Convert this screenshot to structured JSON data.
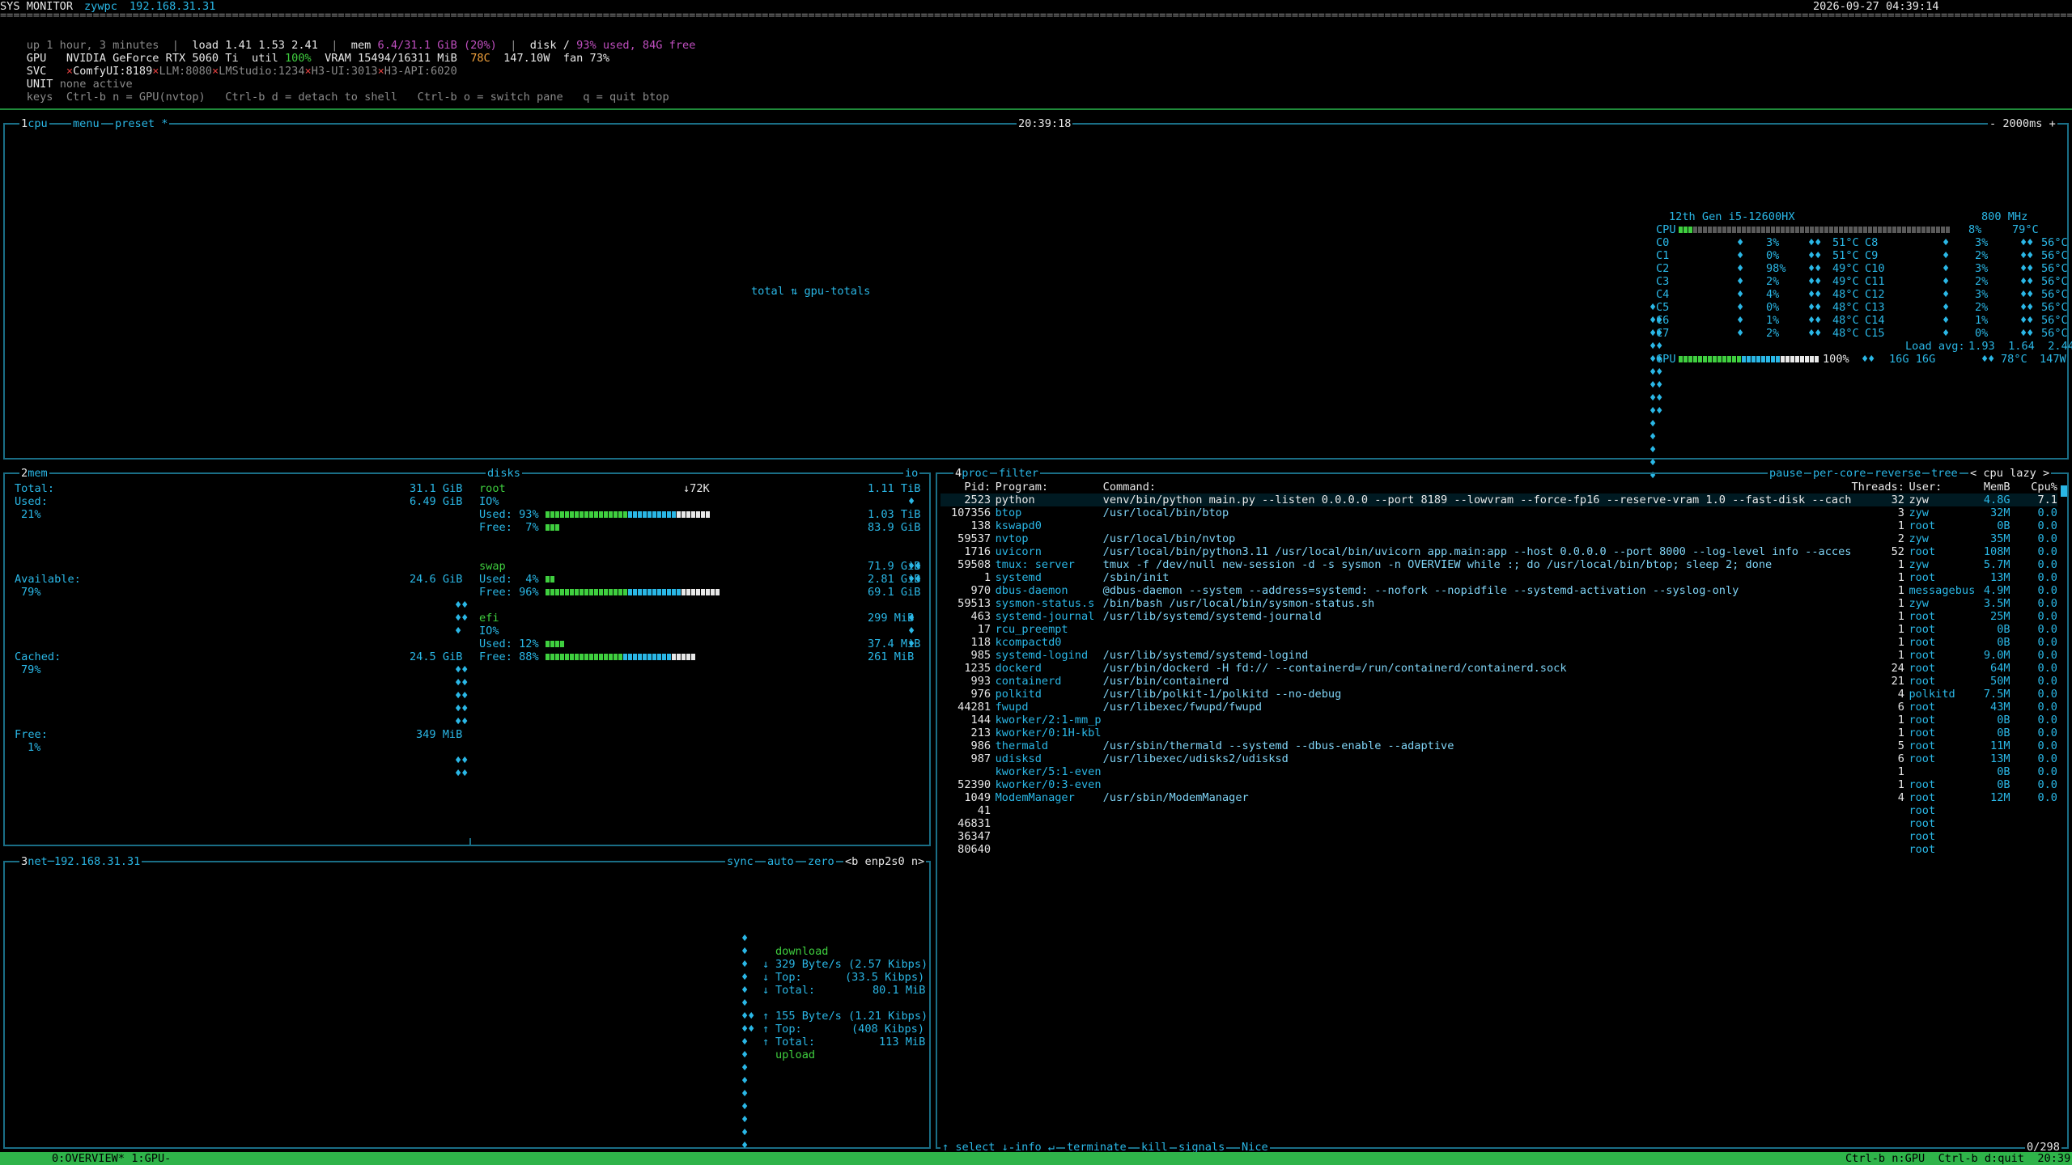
{
  "header": {
    "title": "SYS MONITOR",
    "user": "zywpc",
    "ip": "192.168.31.31",
    "datetime": "2026-09-27 04:39:14",
    "separator_line": "==========================================================================================================================================================================================================================================================================================================================================================",
    "uptime": "up 1 hour, 3 minutes",
    "load_label": "load",
    "load_values": "1.41 1.53 2.41",
    "mem_label": "mem",
    "mem_value": "6.4/31.1 GiB (20%)",
    "disk_label": "disk /",
    "disk_value": "93% used, 84G free",
    "gpu_line_label": "GPU",
    "gpu_name": "NVIDIA GeForce RTX 5060 Ti",
    "gpu_util_label": "util",
    "gpu_util": "100%",
    "gpu_vram_label": "VRAM",
    "gpu_vram": "15494/16311 MiB",
    "gpu_temp": "78C",
    "gpu_power": "147.10W",
    "gpu_fan_label": "fan",
    "gpu_fan": "73%",
    "svc_label": "SVC",
    "services": [
      {
        "mark": "×",
        "name": "ComfyUI:8189",
        "color": "#e8e8e8"
      },
      {
        "mark": "×",
        "name": "LLM:8080",
        "color": "#8a8a8a"
      },
      {
        "mark": "×",
        "name": "LMStudio:1234",
        "color": "#8a8a8a"
      },
      {
        "mark": "×",
        "name": "H3-UI:3013",
        "color": "#8a8a8a"
      },
      {
        "mark": "×",
        "name": "H3-API:6020",
        "color": "#8a8a8a"
      }
    ],
    "unit_label": "UNIT",
    "unit_value": "none active",
    "keys_label": "keys",
    "keys_value": "Ctrl-b n = GPU(nvtop)   Ctrl-b d = detach to shell   Ctrl-b o = switch pane   q = quit btop"
  },
  "cpu_box": {
    "tabs": [
      "cpu",
      "menu",
      "preset *"
    ],
    "tab_num": "1",
    "clock": "20:39:18",
    "interval": "- 2000ms +",
    "center_label": "total ⇅ gpu-totals",
    "cpu_model": "12th Gen i5-12600HX",
    "freq": "800 MHz",
    "cpu_total_label": "CPU",
    "cpu_total_pct": "8%",
    "cpu_total_temp": "79°C",
    "cores_left": [
      {
        "name": "C0",
        "pct": "3%",
        "temp": "51°C"
      },
      {
        "name": "C1",
        "pct": "0%",
        "temp": "51°C"
      },
      {
        "name": "C2",
        "pct": "98%",
        "temp": "49°C"
      },
      {
        "name": "C3",
        "pct": "2%",
        "temp": "49°C"
      },
      {
        "name": "C4",
        "pct": "4%",
        "temp": "48°C"
      },
      {
        "name": "C5",
        "pct": "0%",
        "temp": "48°C"
      },
      {
        "name": "C6",
        "pct": "1%",
        "temp": "48°C"
      },
      {
        "name": "C7",
        "pct": "2%",
        "temp": "48°C"
      }
    ],
    "cores_right": [
      {
        "name": "C8",
        "pct": "3%",
        "temp": "56°C"
      },
      {
        "name": "C9",
        "pct": "2%",
        "temp": "56°C"
      },
      {
        "name": "C10",
        "pct": "3%",
        "temp": "56°C"
      },
      {
        "name": "C11",
        "pct": "2%",
        "temp": "56°C"
      },
      {
        "name": "C12",
        "pct": "3%",
        "temp": "56°C"
      },
      {
        "name": "C13",
        "pct": "2%",
        "temp": "56°C"
      },
      {
        "name": "C14",
        "pct": "1%",
        "temp": "56°C"
      },
      {
        "name": "C15",
        "pct": "0%",
        "temp": "56°C"
      }
    ],
    "load_avg_label": "Load avg:",
    "load_avg": "1.93  1.64  2.44",
    "gpu_label": "GPU",
    "gpu_pct": "100%",
    "gpu_mem": "16G 16G",
    "gpu_temp": "78°C",
    "gpu_power": "147W"
  },
  "mem_box": {
    "tab_num": "2",
    "title": "mem",
    "total_label": "Total:",
    "total": "31.1 GiB",
    "used_label": "Used:",
    "used": "6.49 GiB",
    "used_pct": "21%",
    "available_label": "Available:",
    "available": "24.6 GiB",
    "available_pct": "79%",
    "cached_label": "Cached:",
    "cached": "24.5 GiB",
    "cached_pct": "79%",
    "free_label": "Free:",
    "free": "349 MiB",
    "free_pct": "1%"
  },
  "disks_box": {
    "title": "disks",
    "io_label": "io",
    "io_rate": "↓72K",
    "disks": [
      {
        "name": "root",
        "size": "1.11 TiB",
        "io": "IO%",
        "used_label": "Used:",
        "used_pct": "93%",
        "used": "1.03 TiB",
        "free_label": "Free:",
        "free_pct": "7%",
        "free": "83.9 GiB",
        "used_frac": 0.93,
        "free_frac": 0.07
      },
      {
        "name": "swap",
        "size": "71.9 GiB",
        "io": "",
        "used_label": "Used:",
        "used_pct": "4%",
        "used": "2.81 GiB",
        "free_label": "Free:",
        "free_pct": "96%",
        "free": "69.1 GiB",
        "used_frac": 0.04,
        "free_frac": 0.96
      },
      {
        "name": "efi",
        "size": "299 MiB",
        "io": "IO%",
        "used_label": "Used:",
        "used_pct": "12%",
        "used": "37.4 MiB",
        "free_label": "Free:",
        "free_pct": "88%",
        "free": "261 MiB",
        "used_frac": 0.12,
        "free_frac": 0.88
      }
    ]
  },
  "net_box": {
    "tab_num": "3",
    "title": "net",
    "ip": "192.168.31.31",
    "controls": [
      "sync",
      "auto",
      "zero",
      "<b enp2s0 n>"
    ],
    "download_label": "download",
    "down_rate": "329 Byte/s (2.57 Kibps)",
    "down_top_label": "Top:",
    "down_top": "(33.5 Kibps)",
    "down_total_label": "Total:",
    "down_total": "80.1 MiB",
    "up_rate": "155 Byte/s (1.21 Kibps)",
    "up_top_label": "Top:",
    "up_top": "(408 Kibps)",
    "up_total_label": "Total:",
    "up_total": "113 MiB",
    "upload_label": "upload"
  },
  "proc_box": {
    "tab_num": "4",
    "title": "proc",
    "filter_label": "filter",
    "controls": [
      "pause",
      "per-core",
      "reverse",
      "tree",
      "< cpu lazy >"
    ],
    "columns": {
      "pid": "Pid:",
      "program": "Program:",
      "command": "Command:",
      "threads": "Threads:",
      "user": "User:",
      "mem": "MemB",
      "cpu": "Cpu%"
    },
    "rows": [
      {
        "pid": "2523",
        "program": "python",
        "command": "venv/bin/python main.py --listen 0.0.0.0 --port 8189 --lowvram --force-fp16 --reserve-vram 1.0 --fast-disk --cach",
        "threads": "32",
        "user": "zyw",
        "mem": "4.8G",
        "cpu": "7.1"
      },
      {
        "pid": "107356",
        "program": "btop",
        "command": "/usr/local/bin/btop",
        "threads": "3",
        "user": "zyw",
        "mem": "32M",
        "cpu": "0.0"
      },
      {
        "pid": "138",
        "program": "kswapd0",
        "command": "",
        "threads": "1",
        "user": "root",
        "mem": "0B",
        "cpu": "0.0"
      },
      {
        "pid": "59537",
        "program": "nvtop",
        "command": "/usr/local/bin/nvtop",
        "threads": "2",
        "user": "zyw",
        "mem": "35M",
        "cpu": "0.0"
      },
      {
        "pid": "1716",
        "program": "uvicorn",
        "command": "/usr/local/bin/python3.11 /usr/local/bin/uvicorn app.main:app --host 0.0.0.0 --port 8000 --log-level info --acces",
        "threads": "52",
        "user": "root",
        "mem": "108M",
        "cpu": "0.0"
      },
      {
        "pid": "59508",
        "program": "tmux: server",
        "command": "tmux -f /dev/null new-session -d -s sysmon -n OVERVIEW while :; do /usr/local/bin/btop; sleep 2; done",
        "threads": "1",
        "user": "zyw",
        "mem": "5.7M",
        "cpu": "0.0"
      },
      {
        "pid": "1",
        "program": "systemd",
        "command": "/sbin/init",
        "threads": "1",
        "user": "root",
        "mem": "13M",
        "cpu": "0.0"
      },
      {
        "pid": "970",
        "program": "dbus-daemon",
        "command": "@dbus-daemon --system --address=systemd: --nofork --nopidfile --systemd-activation --syslog-only",
        "threads": "1",
        "user": "messagebus",
        "mem": "4.9M",
        "cpu": "0.0"
      },
      {
        "pid": "59513",
        "program": "sysmon-status.s",
        "command": "/bin/bash /usr/local/bin/sysmon-status.sh",
        "threads": "1",
        "user": "zyw",
        "mem": "3.5M",
        "cpu": "0.0"
      },
      {
        "pid": "463",
        "program": "systemd-journal",
        "command": "/usr/lib/systemd/systemd-journald",
        "threads": "1",
        "user": "root",
        "mem": "25M",
        "cpu": "0.0"
      },
      {
        "pid": "17",
        "program": "rcu_preempt",
        "command": "",
        "threads": "1",
        "user": "root",
        "mem": "0B",
        "cpu": "0.0"
      },
      {
        "pid": "118",
        "program": "kcompactd0",
        "command": "",
        "threads": "1",
        "user": "root",
        "mem": "0B",
        "cpu": "0.0"
      },
      {
        "pid": "985",
        "program": "systemd-logind",
        "command": "/usr/lib/systemd/systemd-logind",
        "threads": "1",
        "user": "root",
        "mem": "9.0M",
        "cpu": "0.0"
      },
      {
        "pid": "1235",
        "program": "dockerd",
        "command": "/usr/bin/dockerd -H fd:// --containerd=/run/containerd/containerd.sock",
        "threads": "24",
        "user": "root",
        "mem": "64M",
        "cpu": "0.0"
      },
      {
        "pid": "993",
        "program": "containerd",
        "command": "/usr/bin/containerd",
        "threads": "21",
        "user": "root",
        "mem": "50M",
        "cpu": "0.0"
      },
      {
        "pid": "976",
        "program": "polkitd",
        "command": "/usr/lib/polkit-1/polkitd --no-debug",
        "threads": "4",
        "user": "polkitd",
        "mem": "7.5M",
        "cpu": "0.0"
      },
      {
        "pid": "44281",
        "program": "fwupd",
        "command": "/usr/libexec/fwupd/fwupd",
        "threads": "6",
        "user": "root",
        "mem": "43M",
        "cpu": "0.0"
      },
      {
        "pid": "144",
        "program": "kworker/2:1-mm_p",
        "command": "",
        "threads": "1",
        "user": "root",
        "mem": "0B",
        "cpu": "0.0"
      },
      {
        "pid": "213",
        "program": "kworker/0:1H-kbl",
        "command": "",
        "threads": "1",
        "user": "root",
        "mem": "0B",
        "cpu": "0.0"
      },
      {
        "pid": "986",
        "program": "thermald",
        "command": "/usr/sbin/thermald --systemd --dbus-enable --adaptive",
        "threads": "5",
        "user": "root",
        "mem": "11M",
        "cpu": "0.0"
      },
      {
        "pid": "987",
        "program": "udisksd",
        "command": "/usr/libexec/udisks2/udisksd",
        "threads": "6",
        "user": "root",
        "mem": "13M",
        "cpu": "0.0"
      },
      {
        "pid": "",
        "program": "kworker/5:1-even",
        "command": "",
        "threads": "1",
        "user": "",
        "mem": "0B",
        "cpu": "0.0"
      },
      {
        "pid": "52390",
        "program": "kworker/0:3-even",
        "command": "",
        "threads": "1",
        "user": "root",
        "mem": "0B",
        "cpu": "0.0"
      },
      {
        "pid": "1049",
        "program": "ModemManager",
        "command": "/usr/sbin/ModemManager",
        "threads": "4",
        "user": "root",
        "mem": "12M",
        "cpu": "0.0"
      },
      {
        "pid": "41",
        "program": "",
        "command": "",
        "threads": "",
        "user": "root",
        "mem": "",
        "cpu": ""
      },
      {
        "pid": "46831",
        "program": "",
        "command": "",
        "threads": "",
        "user": "root",
        "mem": "",
        "cpu": ""
      },
      {
        "pid": "36347",
        "program": "",
        "command": "",
        "threads": "",
        "user": "root",
        "mem": "",
        "cpu": ""
      },
      {
        "pid": "80640",
        "program": "",
        "command": "",
        "threads": "",
        "user": "root",
        "mem": "",
        "cpu": ""
      }
    ],
    "footer": [
      "↑ select ↓",
      "info ↵",
      "terminate",
      "kill",
      "signals",
      "Nice"
    ],
    "count": "0/298"
  },
  "statusbar": {
    "left": "0:OVERVIEW* 1:GPU-",
    "right": "Ctrl-b n:GPU  Ctrl-b d:quit  20:39"
  },
  "colors": {
    "border": "#1a6e86",
    "accent_cyan": "#2ab7e6",
    "green": "#3fcf3f",
    "status_bg": "#2fb44a"
  }
}
